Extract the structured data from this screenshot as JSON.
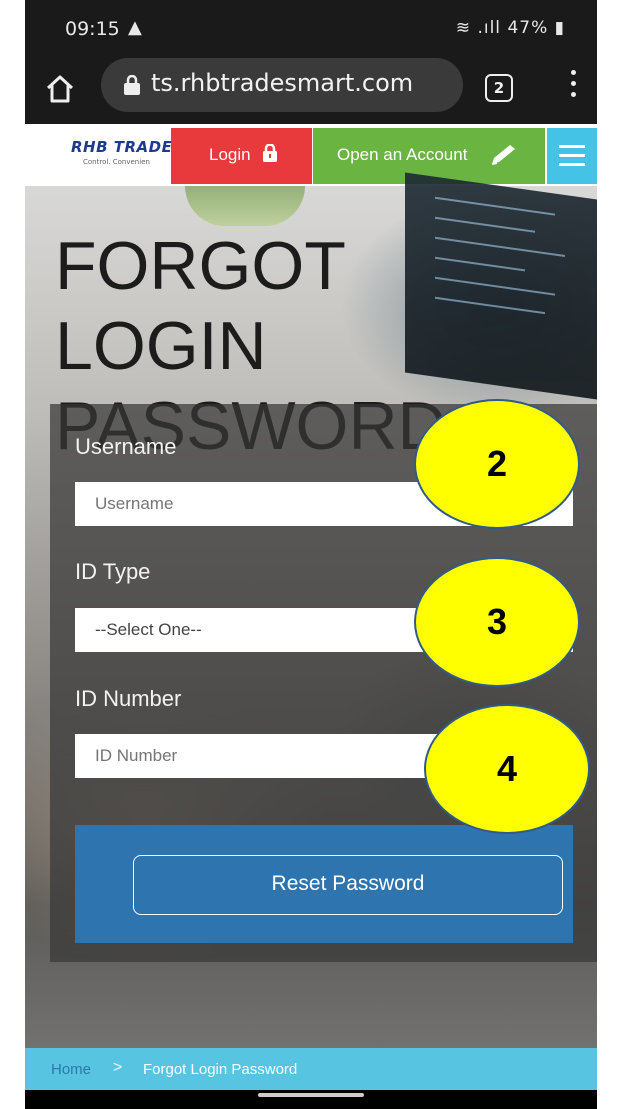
{
  "status_bar": {
    "time": "09:15",
    "battery": "47%"
  },
  "browser": {
    "url": "ts.rhbtradesmart.com",
    "tab_count": "2"
  },
  "nav": {
    "logo_text": "RHB TRADE",
    "logo_tagline": "Control. Convenien",
    "login_label": "Login",
    "open_account_label": "Open an Account"
  },
  "page": {
    "title_line1": "FORGOT LOGIN",
    "title_line2": "PASSWORD"
  },
  "form": {
    "username_label": "Username",
    "username_placeholder": "Username",
    "id_type_label": "ID Type",
    "id_type_selected": "--Select One--",
    "id_number_label": "ID Number",
    "id_number_placeholder": "ID Number",
    "reset_button": "Reset Password"
  },
  "breadcrumb": {
    "home": "Home",
    "separator": ">",
    "current": "Forgot Login Password"
  },
  "callouts": [
    "2",
    "3",
    "4"
  ],
  "colors": {
    "login_red": "#e8393c",
    "open_account_green": "#6ab542",
    "menu_blue": "#45c3e6",
    "reset_blue": "#2e74ae",
    "callout_yellow": "#ffff00"
  }
}
